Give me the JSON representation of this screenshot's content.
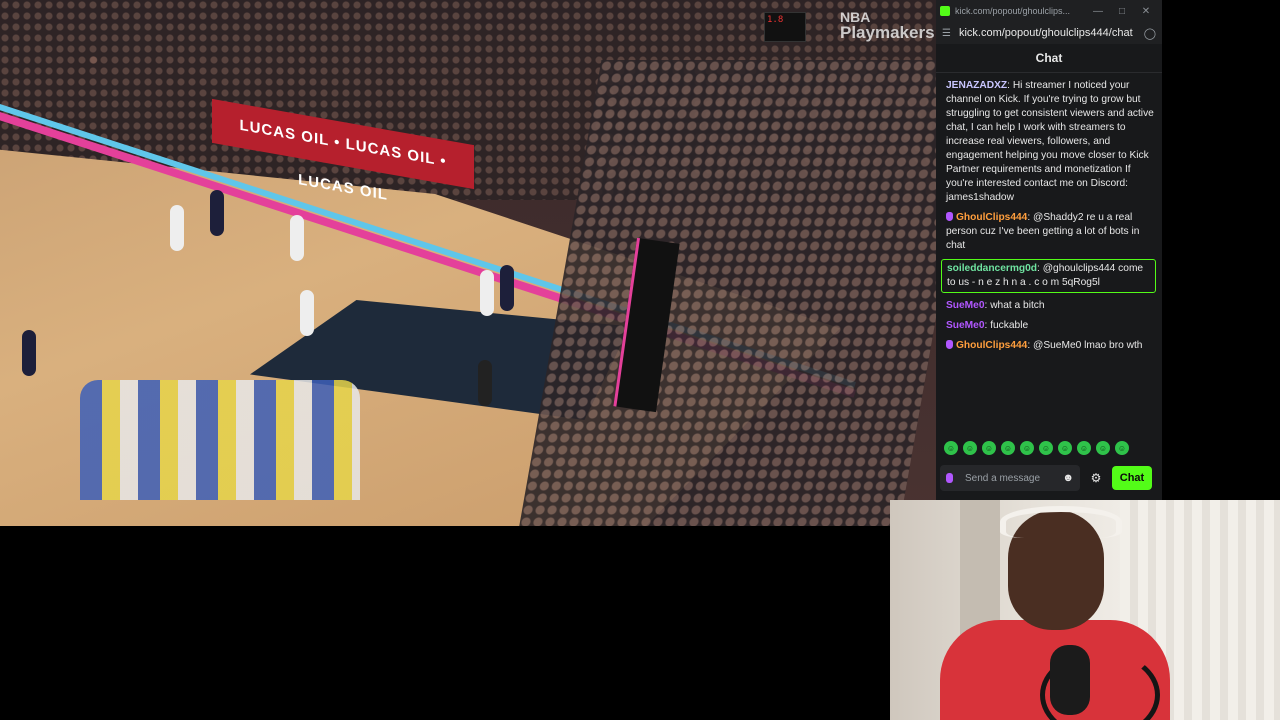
{
  "video": {
    "banner_text": "LUCAS OIL • LUCAS OIL • LUCAS OIL",
    "watermark_line1": "NBA",
    "watermark_line2": "Playmakers",
    "shot_clock": "1.8"
  },
  "window": {
    "title": "kick.com/popout/ghoulclips...",
    "url": "kick.com/popout/ghoulclips444/chat",
    "minimize": "—",
    "maximize": "□",
    "close": "✕"
  },
  "chat": {
    "header": "Chat",
    "messages": [
      {
        "user": "JENAZADXZ",
        "color": "#c9c6ff",
        "badge": false,
        "highlight": false,
        "text": "Hi streamer I noticed your channel on Kick. If you're trying to grow but struggling to get consistent viewers and active chat, I can help I work with streamers to increase real viewers, followers, and engagement helping you move closer to Kick Partner requirements and monetization If you're interested contact me on Discord: james1shadow"
      },
      {
        "user": "GhoulClips444",
        "color": "#ff9e3d",
        "badge": true,
        "highlight": false,
        "text": "@Shaddy2 re u a real person cuz I've been getting a lot of bots in chat"
      },
      {
        "user": "soileddancermg0d",
        "color": "#6fe3a0",
        "badge": false,
        "highlight": true,
        "text": "@ghoulclips444 come to us - n e z h n a . c o m 5qRog5l"
      },
      {
        "user": "SueMe0",
        "color": "#b157ff",
        "badge": false,
        "highlight": false,
        "text": "what a bitch"
      },
      {
        "user": "SueMe0",
        "color": "#b157ff",
        "badge": false,
        "highlight": false,
        "text": "fuckable"
      },
      {
        "user": "GhoulClips444",
        "color": "#ff9e3d",
        "badge": true,
        "highlight": false,
        "text": "@SueMe0 lmao bro wth"
      }
    ],
    "input_placeholder": "Send a message",
    "send_label": "Chat",
    "emotes": [
      "emote-1",
      "emote-2",
      "emote-3",
      "emote-4",
      "emote-5",
      "emote-6",
      "emote-7",
      "emote-8",
      "emote-9",
      "emote-10"
    ]
  }
}
